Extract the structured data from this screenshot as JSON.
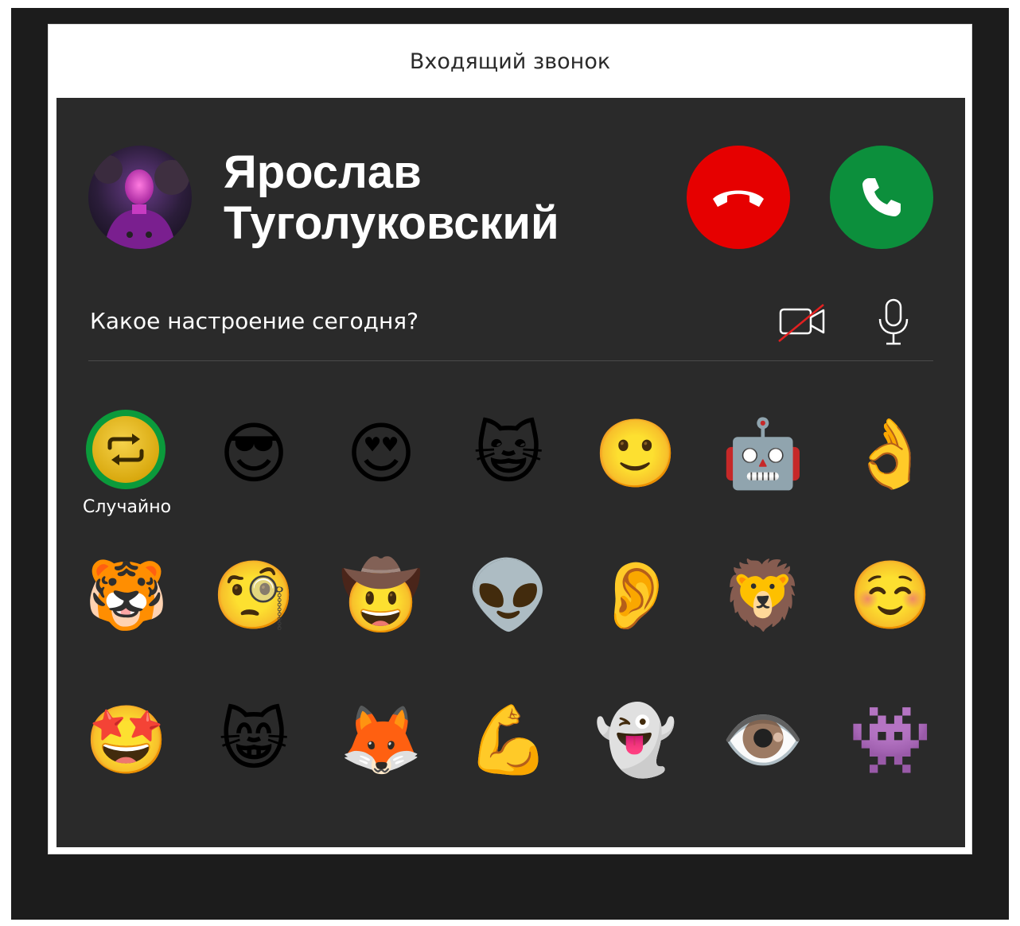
{
  "window": {
    "title": "Входящий звонок"
  },
  "caller": {
    "first_name": "Ярослав",
    "last_name": "Туголуковский",
    "avatar_icon": "person-avatar-icon"
  },
  "actions": {
    "decline_icon": "phone-hangup-icon",
    "accept_icon": "phone-icon",
    "decline_color": "#e60000",
    "accept_color": "#0c8f3c"
  },
  "mood": {
    "question": "Какое настроение сегодня?",
    "camera_icon": "video-off-icon",
    "mic_icon": "microphone-icon"
  },
  "random": {
    "label": "Случайно",
    "icon": "shuffle-repeat-icon",
    "selected": true,
    "ring_color": "#0b9a3b"
  },
  "emojis": [
    [
      "😎",
      "😍",
      "😺",
      "🙂",
      "🤖",
      "👌"
    ],
    [
      "🐯",
      "🧐",
      "🤠",
      "👽",
      "👂",
      "🦁",
      "☺️"
    ],
    [
      "🤩",
      "😸",
      "🦊",
      "💪",
      "👻",
      "👁️",
      "👾"
    ]
  ]
}
